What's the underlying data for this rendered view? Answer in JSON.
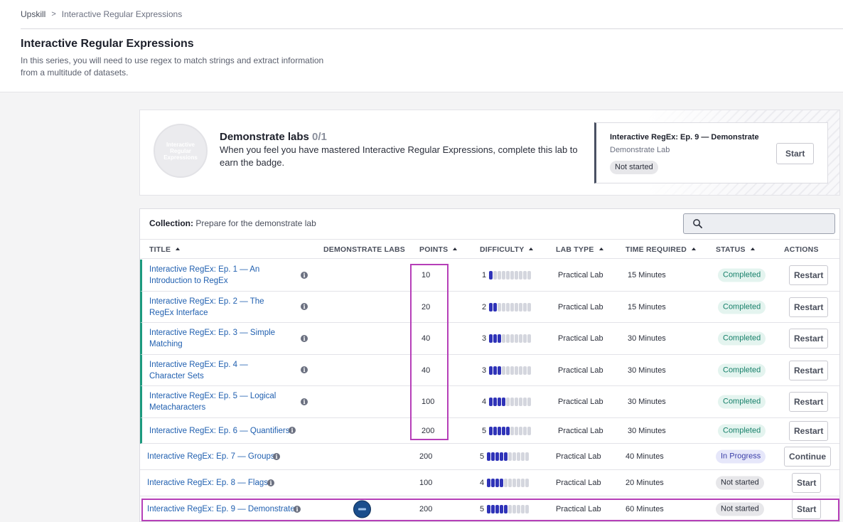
{
  "breadcrumb": {
    "root": "Upskill",
    "separator": ">",
    "current": "Interactive Regular Expressions"
  },
  "page": {
    "title": "Interactive Regular Expressions",
    "description": "In this series, you will need to use regex to match strings and extract information from a multitude of datasets."
  },
  "badge_card": {
    "badge_text": "Interactive Regular Expressions",
    "heading": "Demonstrate labs",
    "count": "0/1",
    "description": "When you feel you have mastered Interactive Regular Expressions, complete this lab to earn the badge.",
    "lab": {
      "title": "Interactive RegEx: Ep. 9 — Demonstrate",
      "subtitle": "Demonstrate Lab",
      "status": "Not started",
      "button": "Start"
    }
  },
  "collection": {
    "label": "Collection:",
    "name": "Prepare for the demonstrate lab",
    "search_placeholder": ""
  },
  "columns": {
    "title": "TITLE",
    "demonstrate_labs": "DEMONSTRATE LABS",
    "points": "POINTS",
    "difficulty": "DIFFICULTY",
    "lab_type": "LAB TYPE",
    "time_required": "TIME REQUIRED",
    "status": "STATUS",
    "actions": "ACTIONS"
  },
  "rows": [
    {
      "title": "Interactive RegEx: Ep. 1 — An Introduction to RegEx",
      "points": "10",
      "difficulty_label": "1",
      "difficulty": 1,
      "lab_type": "Practical Lab",
      "time": "15 Minutes",
      "status": "Completed",
      "action": "Restart"
    },
    {
      "title": "Interactive RegEx: Ep. 2 — The RegEx Interface",
      "points": "20",
      "difficulty_label": "2",
      "difficulty": 2,
      "lab_type": "Practical Lab",
      "time": "15 Minutes",
      "status": "Completed",
      "action": "Restart"
    },
    {
      "title": "Interactive RegEx: Ep. 3 — Simple Matching",
      "points": "40",
      "difficulty_label": "3",
      "difficulty": 3,
      "lab_type": "Practical Lab",
      "time": "30 Minutes",
      "status": "Completed",
      "action": "Restart"
    },
    {
      "title": "Interactive RegEx: Ep. 4 — Character Sets",
      "points": "40",
      "difficulty_label": "3",
      "difficulty": 3,
      "lab_type": "Practical Lab",
      "time": "30 Minutes",
      "status": "Completed",
      "action": "Restart"
    },
    {
      "title": "Interactive RegEx: Ep. 5 — Logical Metacharacters",
      "points": "100",
      "difficulty_label": "4",
      "difficulty": 4,
      "lab_type": "Practical Lab",
      "time": "30 Minutes",
      "status": "Completed",
      "action": "Restart"
    },
    {
      "title": "Interactive RegEx: Ep. 6 — Quantifiers",
      "points": "200",
      "difficulty_label": "5",
      "difficulty": 5,
      "lab_type": "Practical Lab",
      "time": "30 Minutes",
      "status": "Completed",
      "action": "Restart"
    },
    {
      "title": "Interactive RegEx: Ep. 7 — Groups",
      "points": "200",
      "difficulty_label": "5",
      "difficulty": 5,
      "lab_type": "Practical Lab",
      "time": "40 Minutes",
      "status": "In Progress",
      "action": "Continue"
    },
    {
      "title": "Interactive RegEx: Ep. 8 — Flags",
      "points": "100",
      "difficulty_label": "4",
      "difficulty": 4,
      "lab_type": "Practical Lab",
      "time": "20 Minutes",
      "status": "Not started",
      "action": "Start"
    },
    {
      "title": "Interactive RegEx: Ep. 9 — Demonstrate",
      "points": "200",
      "difficulty_label": "5",
      "difficulty": 5,
      "lab_type": "Practical Lab",
      "time": "60 Minutes",
      "status": "Not started",
      "action": "Start"
    }
  ],
  "difficulty_max": 10,
  "colors": {
    "link": "#2160b0",
    "completed_border": "#1c9a7e",
    "difficulty_on": "#2f33b8",
    "highlight": "#b63fb8"
  }
}
